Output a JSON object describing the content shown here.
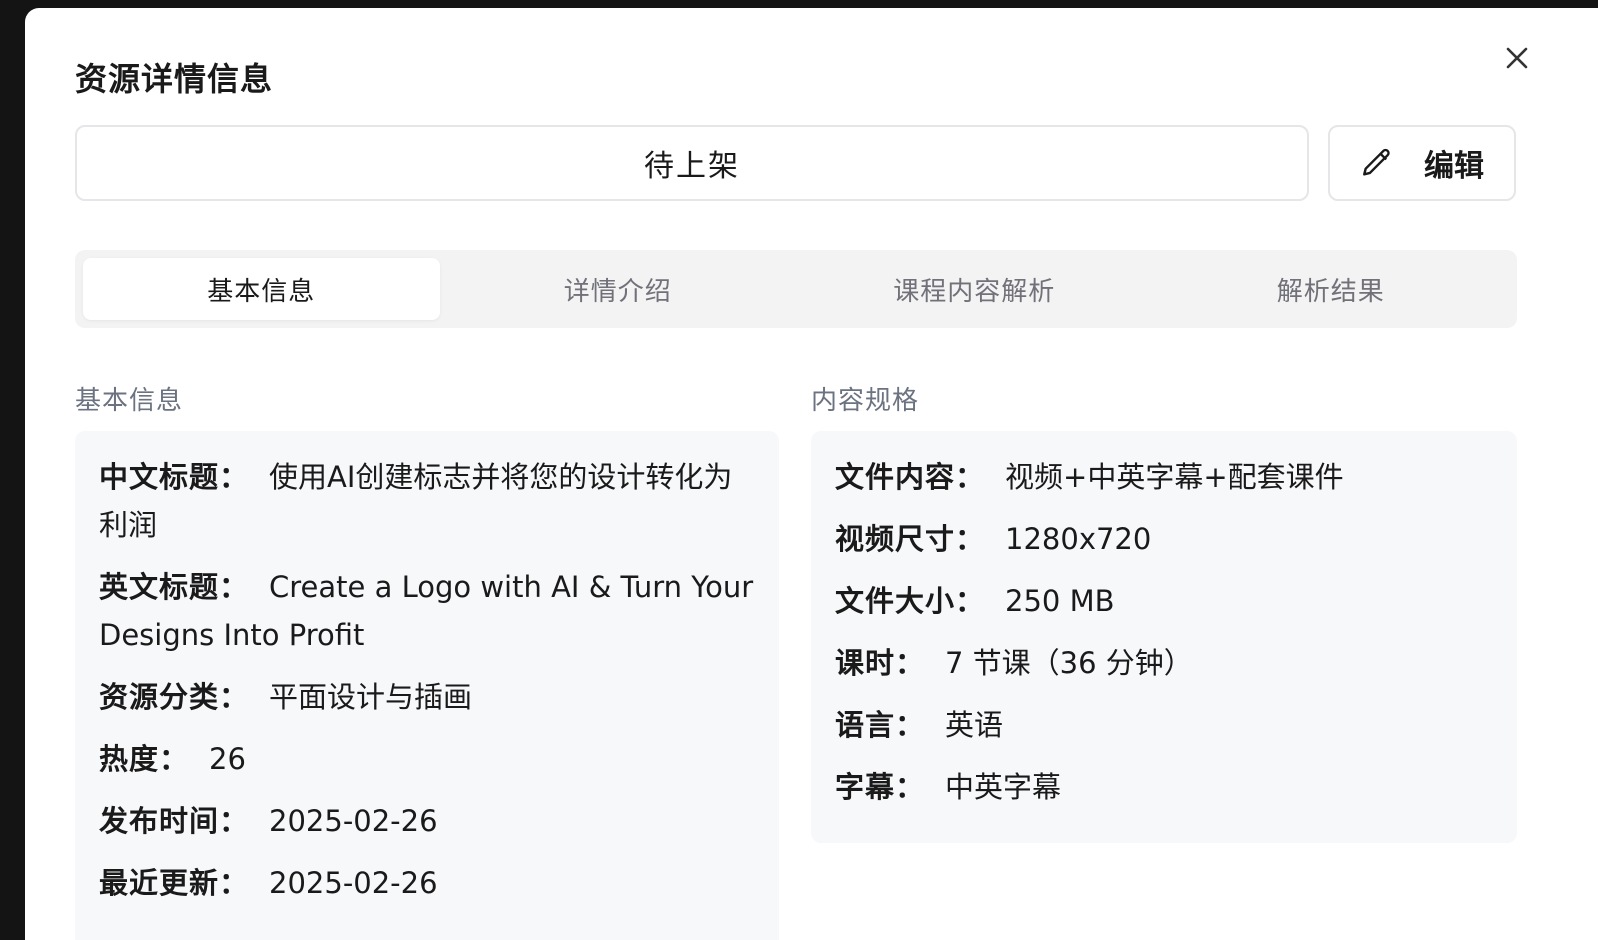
{
  "dialog": {
    "title": "资源详情信息",
    "status": "待上架",
    "edit_label": "编辑"
  },
  "tabs": [
    {
      "label": "基本信息",
      "active": true
    },
    {
      "label": "详情介绍",
      "active": false
    },
    {
      "label": "课程内容解析",
      "active": false
    },
    {
      "label": "解析结果",
      "active": false
    }
  ],
  "basic": {
    "heading": "基本信息",
    "fields": [
      {
        "label": "中文标题：",
        "value": "使用AI创建标志并将您的设计转化为利润"
      },
      {
        "label": "英文标题：",
        "value": "Create a Logo with AI & Turn Your Designs Into Profit"
      },
      {
        "label": "资源分类：",
        "value": "平面设计与插画"
      },
      {
        "label": "热度：",
        "value": "26"
      },
      {
        "label": "发布时间：",
        "value": "2025-02-26"
      },
      {
        "label": "最近更新：",
        "value": "2025-02-26"
      }
    ]
  },
  "spec": {
    "heading": "内容规格",
    "fields": [
      {
        "label": "文件内容：",
        "value": "视频+中英字幕+配套课件"
      },
      {
        "label": "视频尺寸：",
        "value": "1280x720"
      },
      {
        "label": "文件大小：",
        "value": "250 MB"
      },
      {
        "label": "课时：",
        "value": "7 节课（36 分钟）"
      },
      {
        "label": "语言：",
        "value": "英语"
      },
      {
        "label": "字幕：",
        "value": "中英字幕"
      }
    ]
  }
}
